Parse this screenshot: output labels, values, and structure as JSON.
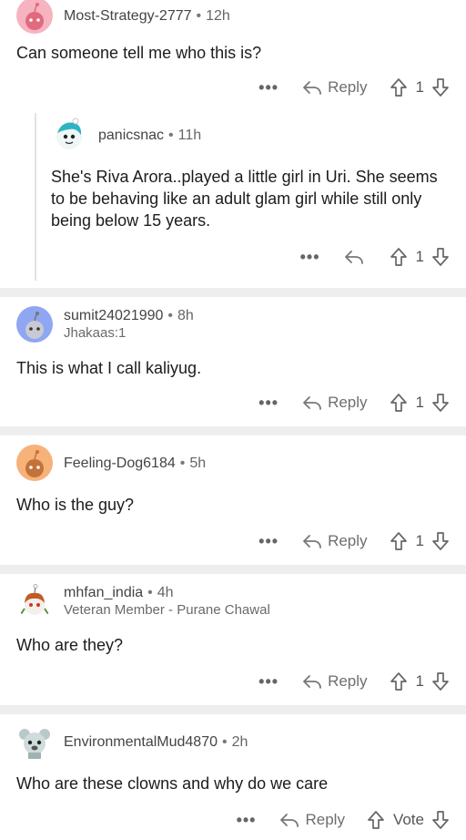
{
  "comments": [
    {
      "author": "Most-Strategy-2777",
      "time": "12h",
      "body": "Can someone tell me who this is?",
      "reply_label": "Reply",
      "votes": "1",
      "avatar_color": "#f6b3c0"
    },
    {
      "author": "panicsnac",
      "time": "11h",
      "body": "She's Riva Arora..played a little girl in Uri. She seems to be behaving like an adult glam girl while still only being below 15 years.",
      "votes": "1"
    },
    {
      "author": "sumit24021990",
      "time": "8h",
      "flair": "Jhakaas:1",
      "body": "This is what I call kaliyug.",
      "reply_label": "Reply",
      "votes": "1",
      "avatar_color": "#8fa6f2"
    },
    {
      "author": "Feeling-Dog6184",
      "time": "5h",
      "body": "Who is the guy?",
      "reply_label": "Reply",
      "votes": "1",
      "avatar_color": "#f7b27a"
    },
    {
      "author": "mhfan_india",
      "time": "4h",
      "flair": "Veteran Member - Purane Chawal",
      "body": "Who are they?",
      "reply_label": "Reply",
      "votes": "1"
    },
    {
      "author": "EnvironmentalMud4870",
      "time": "2h",
      "body": "Who are these clowns and why do we care",
      "reply_label": "Reply",
      "votes": "Vote"
    }
  ],
  "more_label": "•••",
  "dot": "•",
  "colors": {
    "separator": "#eeeeee",
    "text": "#1c1c1c",
    "meta": "#666666"
  }
}
